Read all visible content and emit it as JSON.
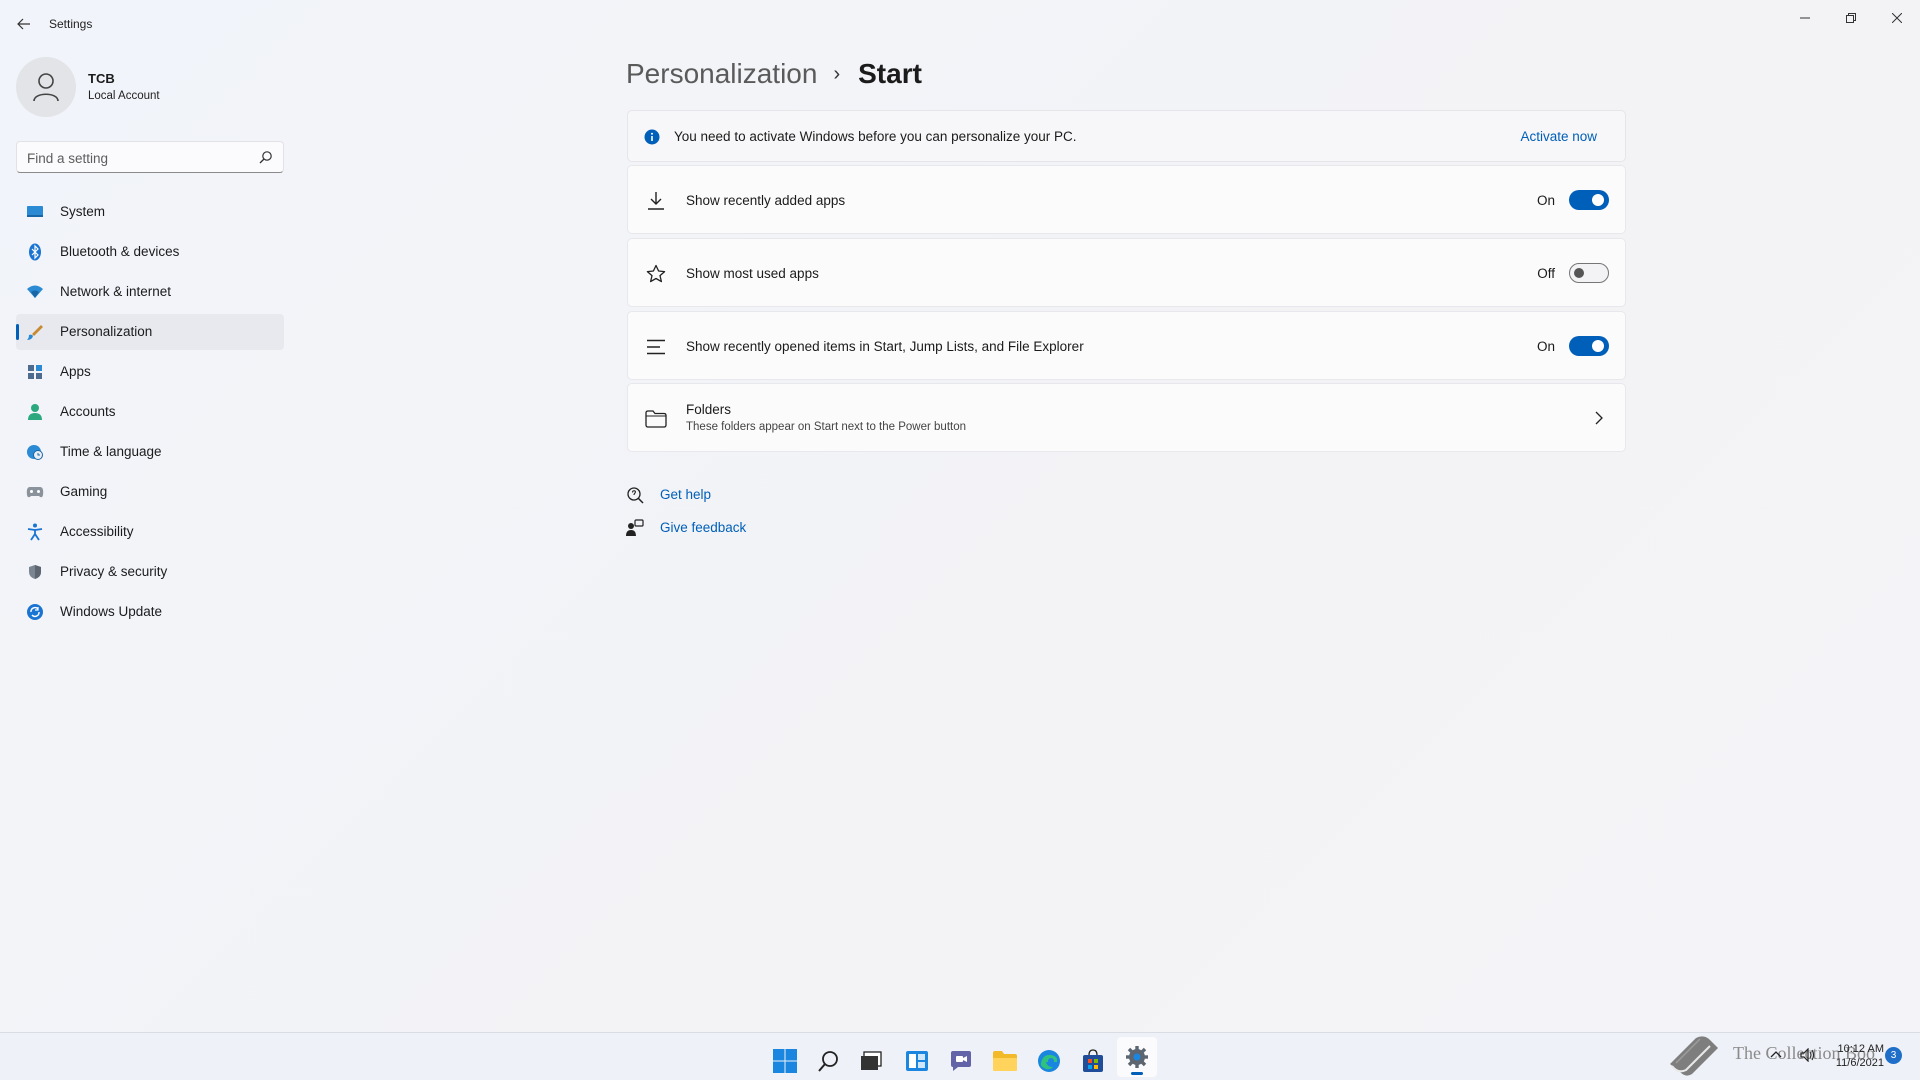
{
  "window": {
    "title": "Settings"
  },
  "user": {
    "name": "TCB",
    "account_type": "Local Account"
  },
  "search": {
    "placeholder": "Find a setting"
  },
  "sidebar": {
    "items": [
      {
        "label": "System",
        "icon": "system-icon",
        "selected": false
      },
      {
        "label": "Bluetooth & devices",
        "icon": "bluetooth-icon",
        "selected": false
      },
      {
        "label": "Network & internet",
        "icon": "wifi-icon",
        "selected": false
      },
      {
        "label": "Personalization",
        "icon": "brush-icon",
        "selected": true
      },
      {
        "label": "Apps",
        "icon": "apps-icon",
        "selected": false
      },
      {
        "label": "Accounts",
        "icon": "person-icon",
        "selected": false
      },
      {
        "label": "Time & language",
        "icon": "globe-clock-icon",
        "selected": false
      },
      {
        "label": "Gaming",
        "icon": "gamepad-icon",
        "selected": false
      },
      {
        "label": "Accessibility",
        "icon": "accessibility-icon",
        "selected": false
      },
      {
        "label": "Privacy & security",
        "icon": "shield-icon",
        "selected": false
      },
      {
        "label": "Windows Update",
        "icon": "update-icon",
        "selected": false
      }
    ]
  },
  "breadcrumb": {
    "parent": "Personalization",
    "separator": "›",
    "current": "Start"
  },
  "banner": {
    "text": "You need to activate Windows before you can personalize your PC.",
    "link": "Activate now"
  },
  "settings": {
    "recent_apps": {
      "label": "Show recently added apps",
      "state": "On",
      "on": true
    },
    "most_used": {
      "label": "Show most used apps",
      "state": "Off",
      "on": false
    },
    "recent_items": {
      "label": "Show recently opened items in Start, Jump Lists, and File Explorer",
      "state": "On",
      "on": true
    },
    "folders": {
      "title": "Folders",
      "subtitle": "These folders appear on Start next to the Power button"
    }
  },
  "help": {
    "get_help": "Get help",
    "give_feedback": "Give feedback"
  },
  "taskbar": {
    "watermark": "The Collection Boo",
    "time": "10:12 AM",
    "date": "11/6/2021",
    "notification_count": "3"
  },
  "colors": {
    "accent": "#005fb8",
    "background": "#f3f3f6"
  }
}
